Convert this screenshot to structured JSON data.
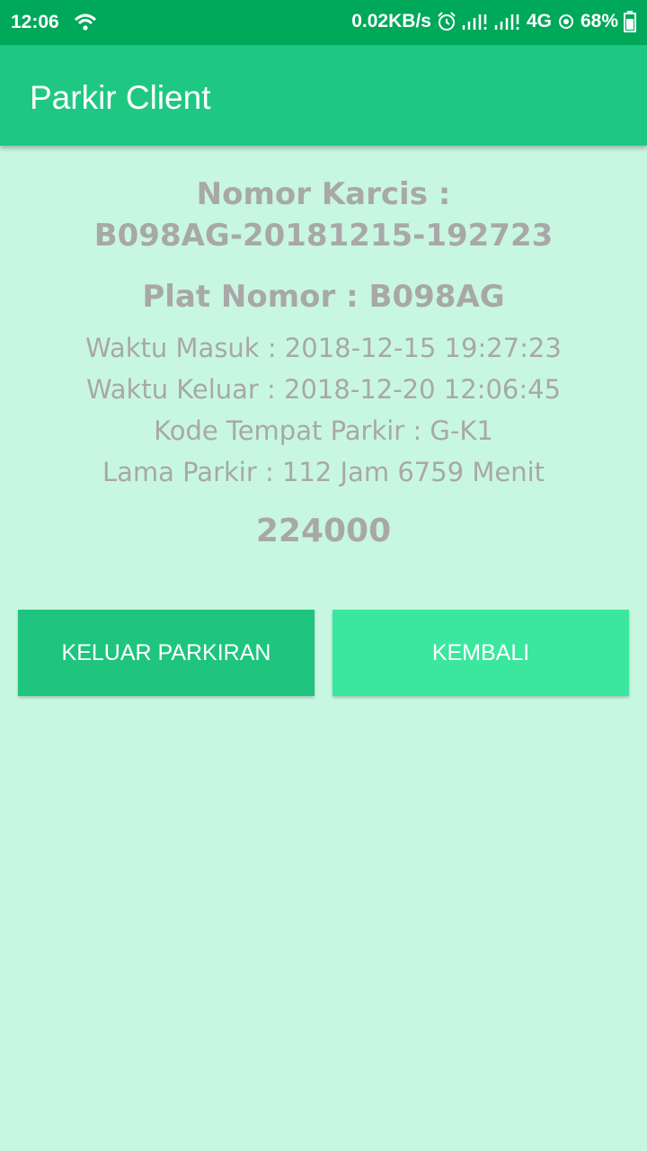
{
  "status_bar": {
    "time": "12:06",
    "net_speed": "0.02KB/s",
    "network": "4G",
    "battery": "68%"
  },
  "app_bar": {
    "title": "Parkir Client"
  },
  "ticket": {
    "ticket_label": "Nomor Karcis :",
    "ticket_number": "B098AG-20181215-192723",
    "plate_line": "Plat Nomor : B098AG",
    "entry_line": "Waktu Masuk : 2018-12-15 19:27:23",
    "exit_line": "Waktu Keluar : 2018-12-20 12:06:45",
    "spot_line": "Kode Tempat Parkir : G-K1",
    "duration_line": "Lama Parkir : 112 Jam 6759 Menit",
    "amount": "224000"
  },
  "buttons": {
    "exit_label": "KELUAR PARKIRAN",
    "back_label": "KEMBALI"
  },
  "colors": {
    "status_bar": "#00a85a",
    "app_bar": "#1fc882",
    "background": "#c8f7e1",
    "text": "#a8a8a8",
    "button_exit": "#1fc47f",
    "button_back": "#3be79e"
  }
}
